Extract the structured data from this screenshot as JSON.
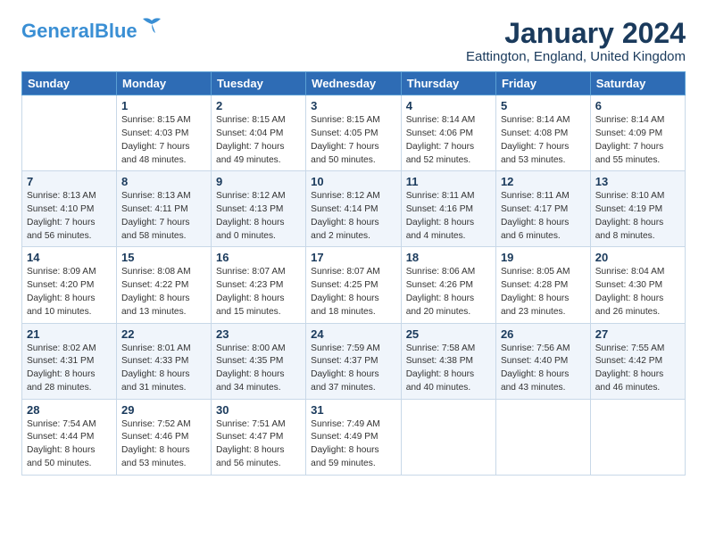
{
  "logo": {
    "line1": "General",
    "line2": "Blue"
  },
  "title": "January 2024",
  "location": "Eattington, England, United Kingdom",
  "days_header": [
    "Sunday",
    "Monday",
    "Tuesday",
    "Wednesday",
    "Thursday",
    "Friday",
    "Saturday"
  ],
  "weeks": [
    [
      {
        "num": "",
        "info": ""
      },
      {
        "num": "1",
        "info": "Sunrise: 8:15 AM\nSunset: 4:03 PM\nDaylight: 7 hours\nand 48 minutes."
      },
      {
        "num": "2",
        "info": "Sunrise: 8:15 AM\nSunset: 4:04 PM\nDaylight: 7 hours\nand 49 minutes."
      },
      {
        "num": "3",
        "info": "Sunrise: 8:15 AM\nSunset: 4:05 PM\nDaylight: 7 hours\nand 50 minutes."
      },
      {
        "num": "4",
        "info": "Sunrise: 8:14 AM\nSunset: 4:06 PM\nDaylight: 7 hours\nand 52 minutes."
      },
      {
        "num": "5",
        "info": "Sunrise: 8:14 AM\nSunset: 4:08 PM\nDaylight: 7 hours\nand 53 minutes."
      },
      {
        "num": "6",
        "info": "Sunrise: 8:14 AM\nSunset: 4:09 PM\nDaylight: 7 hours\nand 55 minutes."
      }
    ],
    [
      {
        "num": "7",
        "info": "Sunrise: 8:13 AM\nSunset: 4:10 PM\nDaylight: 7 hours\nand 56 minutes."
      },
      {
        "num": "8",
        "info": "Sunrise: 8:13 AM\nSunset: 4:11 PM\nDaylight: 7 hours\nand 58 minutes."
      },
      {
        "num": "9",
        "info": "Sunrise: 8:12 AM\nSunset: 4:13 PM\nDaylight: 8 hours\nand 0 minutes."
      },
      {
        "num": "10",
        "info": "Sunrise: 8:12 AM\nSunset: 4:14 PM\nDaylight: 8 hours\nand 2 minutes."
      },
      {
        "num": "11",
        "info": "Sunrise: 8:11 AM\nSunset: 4:16 PM\nDaylight: 8 hours\nand 4 minutes."
      },
      {
        "num": "12",
        "info": "Sunrise: 8:11 AM\nSunset: 4:17 PM\nDaylight: 8 hours\nand 6 minutes."
      },
      {
        "num": "13",
        "info": "Sunrise: 8:10 AM\nSunset: 4:19 PM\nDaylight: 8 hours\nand 8 minutes."
      }
    ],
    [
      {
        "num": "14",
        "info": "Sunrise: 8:09 AM\nSunset: 4:20 PM\nDaylight: 8 hours\nand 10 minutes."
      },
      {
        "num": "15",
        "info": "Sunrise: 8:08 AM\nSunset: 4:22 PM\nDaylight: 8 hours\nand 13 minutes."
      },
      {
        "num": "16",
        "info": "Sunrise: 8:07 AM\nSunset: 4:23 PM\nDaylight: 8 hours\nand 15 minutes."
      },
      {
        "num": "17",
        "info": "Sunrise: 8:07 AM\nSunset: 4:25 PM\nDaylight: 8 hours\nand 18 minutes."
      },
      {
        "num": "18",
        "info": "Sunrise: 8:06 AM\nSunset: 4:26 PM\nDaylight: 8 hours\nand 20 minutes."
      },
      {
        "num": "19",
        "info": "Sunrise: 8:05 AM\nSunset: 4:28 PM\nDaylight: 8 hours\nand 23 minutes."
      },
      {
        "num": "20",
        "info": "Sunrise: 8:04 AM\nSunset: 4:30 PM\nDaylight: 8 hours\nand 26 minutes."
      }
    ],
    [
      {
        "num": "21",
        "info": "Sunrise: 8:02 AM\nSunset: 4:31 PM\nDaylight: 8 hours\nand 28 minutes."
      },
      {
        "num": "22",
        "info": "Sunrise: 8:01 AM\nSunset: 4:33 PM\nDaylight: 8 hours\nand 31 minutes."
      },
      {
        "num": "23",
        "info": "Sunrise: 8:00 AM\nSunset: 4:35 PM\nDaylight: 8 hours\nand 34 minutes."
      },
      {
        "num": "24",
        "info": "Sunrise: 7:59 AM\nSunset: 4:37 PM\nDaylight: 8 hours\nand 37 minutes."
      },
      {
        "num": "25",
        "info": "Sunrise: 7:58 AM\nSunset: 4:38 PM\nDaylight: 8 hours\nand 40 minutes."
      },
      {
        "num": "26",
        "info": "Sunrise: 7:56 AM\nSunset: 4:40 PM\nDaylight: 8 hours\nand 43 minutes."
      },
      {
        "num": "27",
        "info": "Sunrise: 7:55 AM\nSunset: 4:42 PM\nDaylight: 8 hours\nand 46 minutes."
      }
    ],
    [
      {
        "num": "28",
        "info": "Sunrise: 7:54 AM\nSunset: 4:44 PM\nDaylight: 8 hours\nand 50 minutes."
      },
      {
        "num": "29",
        "info": "Sunrise: 7:52 AM\nSunset: 4:46 PM\nDaylight: 8 hours\nand 53 minutes."
      },
      {
        "num": "30",
        "info": "Sunrise: 7:51 AM\nSunset: 4:47 PM\nDaylight: 8 hours\nand 56 minutes."
      },
      {
        "num": "31",
        "info": "Sunrise: 7:49 AM\nSunset: 4:49 PM\nDaylight: 8 hours\nand 59 minutes."
      },
      {
        "num": "",
        "info": ""
      },
      {
        "num": "",
        "info": ""
      },
      {
        "num": "",
        "info": ""
      }
    ]
  ]
}
